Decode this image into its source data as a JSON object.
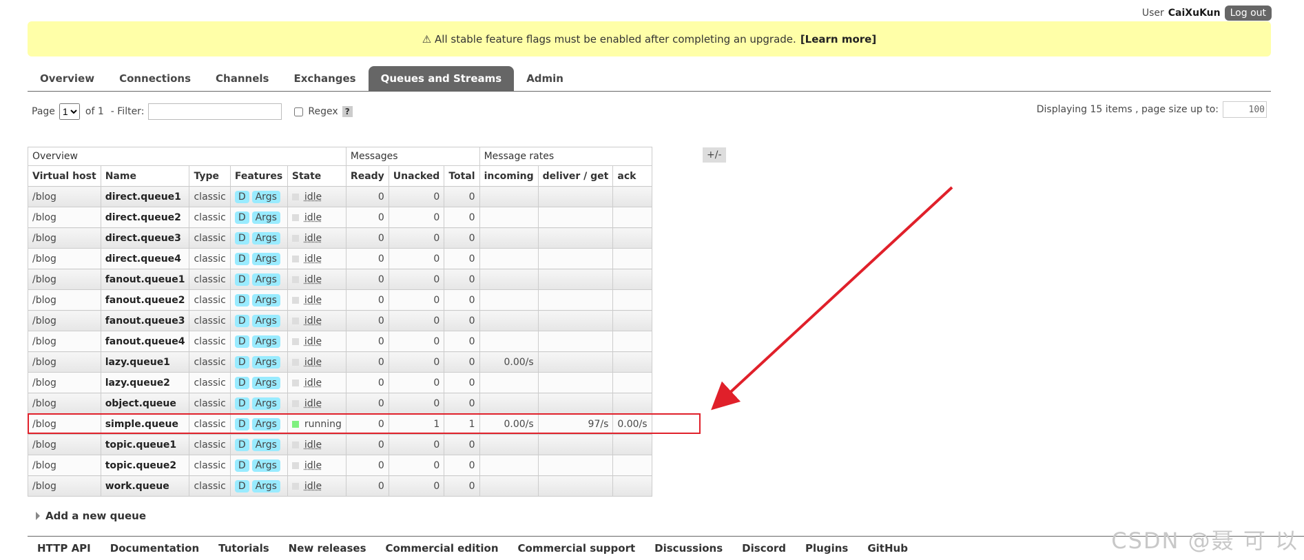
{
  "header": {
    "user_label": "User",
    "user_name": "CaiXuKun",
    "logout_label": "Log out"
  },
  "notice": {
    "icon": "warning-icon",
    "text": "⚠ All stable feature flags must be enabled after completing an upgrade.",
    "link": "[Learn more]"
  },
  "tabs": [
    {
      "label": "Overview"
    },
    {
      "label": "Connections"
    },
    {
      "label": "Channels"
    },
    {
      "label": "Exchanges"
    },
    {
      "label": "Queues and Streams",
      "active": true
    },
    {
      "label": "Admin"
    }
  ],
  "pager": {
    "page_label": "Page",
    "page_value": "1",
    "of_label": "of 1",
    "filter_label": "- Filter:",
    "regex_label": "Regex",
    "help": "?"
  },
  "displaying": {
    "text": "Displaying 15 items , page size up to:",
    "page_size": "100"
  },
  "table": {
    "group_headers": {
      "overview": "Overview",
      "messages": "Messages",
      "rates": "Message rates"
    },
    "plus_minus": "+/-",
    "columns": [
      "Virtual host",
      "Name",
      "Type",
      "Features",
      "State",
      "Ready",
      "Unacked",
      "Total",
      "incoming",
      "deliver / get",
      "ack"
    ],
    "feature_d": "D",
    "feature_args": "Args",
    "rows": [
      {
        "vhost": "/blog",
        "name": "direct.queue1",
        "type": "classic",
        "state": "idle",
        "ready": "0",
        "unacked": "0",
        "total": "0",
        "incoming": "",
        "deliver": "",
        "ack": ""
      },
      {
        "vhost": "/blog",
        "name": "direct.queue2",
        "type": "classic",
        "state": "idle",
        "ready": "0",
        "unacked": "0",
        "total": "0",
        "incoming": "",
        "deliver": "",
        "ack": ""
      },
      {
        "vhost": "/blog",
        "name": "direct.queue3",
        "type": "classic",
        "state": "idle",
        "ready": "0",
        "unacked": "0",
        "total": "0",
        "incoming": "",
        "deliver": "",
        "ack": ""
      },
      {
        "vhost": "/blog",
        "name": "direct.queue4",
        "type": "classic",
        "state": "idle",
        "ready": "0",
        "unacked": "0",
        "total": "0",
        "incoming": "",
        "deliver": "",
        "ack": ""
      },
      {
        "vhost": "/blog",
        "name": "fanout.queue1",
        "type": "classic",
        "state": "idle",
        "ready": "0",
        "unacked": "0",
        "total": "0",
        "incoming": "",
        "deliver": "",
        "ack": ""
      },
      {
        "vhost": "/blog",
        "name": "fanout.queue2",
        "type": "classic",
        "state": "idle",
        "ready": "0",
        "unacked": "0",
        "total": "0",
        "incoming": "",
        "deliver": "",
        "ack": ""
      },
      {
        "vhost": "/blog",
        "name": "fanout.queue3",
        "type": "classic",
        "state": "idle",
        "ready": "0",
        "unacked": "0",
        "total": "0",
        "incoming": "",
        "deliver": "",
        "ack": ""
      },
      {
        "vhost": "/blog",
        "name": "fanout.queue4",
        "type": "classic",
        "state": "idle",
        "ready": "0",
        "unacked": "0",
        "total": "0",
        "incoming": "",
        "deliver": "",
        "ack": ""
      },
      {
        "vhost": "/blog",
        "name": "lazy.queue1",
        "type": "classic",
        "state": "idle",
        "ready": "0",
        "unacked": "0",
        "total": "0",
        "incoming": "0.00/s",
        "deliver": "",
        "ack": ""
      },
      {
        "vhost": "/blog",
        "name": "lazy.queue2",
        "type": "classic",
        "state": "idle",
        "ready": "0",
        "unacked": "0",
        "total": "0",
        "incoming": "",
        "deliver": "",
        "ack": ""
      },
      {
        "vhost": "/blog",
        "name": "object.queue",
        "type": "classic",
        "state": "idle",
        "ready": "0",
        "unacked": "0",
        "total": "0",
        "incoming": "",
        "deliver": "",
        "ack": ""
      },
      {
        "vhost": "/blog",
        "name": "simple.queue",
        "type": "classic",
        "state": "running",
        "ready": "0",
        "unacked": "1",
        "total": "1",
        "incoming": "0.00/s",
        "deliver": "97/s",
        "ack": "0.00/s"
      },
      {
        "vhost": "/blog",
        "name": "topic.queue1",
        "type": "classic",
        "state": "idle",
        "ready": "0",
        "unacked": "0",
        "total": "0",
        "incoming": "",
        "deliver": "",
        "ack": ""
      },
      {
        "vhost": "/blog",
        "name": "topic.queue2",
        "type": "classic",
        "state": "idle",
        "ready": "0",
        "unacked": "0",
        "total": "0",
        "incoming": "",
        "deliver": "",
        "ack": ""
      },
      {
        "vhost": "/blog",
        "name": "work.queue",
        "type": "classic",
        "state": "idle",
        "ready": "0",
        "unacked": "0",
        "total": "0",
        "incoming": "",
        "deliver": "",
        "ack": ""
      }
    ]
  },
  "add_queue_label": "Add a new queue",
  "footer": [
    "HTTP API",
    "Documentation",
    "Tutorials",
    "New releases",
    "Commercial edition",
    "Commercial support",
    "Discussions",
    "Discord",
    "Plugins",
    "GitHub"
  ],
  "watermark": "CSDN @聂 可 以",
  "colors": {
    "annotation": "#e0202a",
    "notice_bg": "#ffffa8",
    "feature_badge": "#99ebff",
    "running": "#80f080"
  }
}
